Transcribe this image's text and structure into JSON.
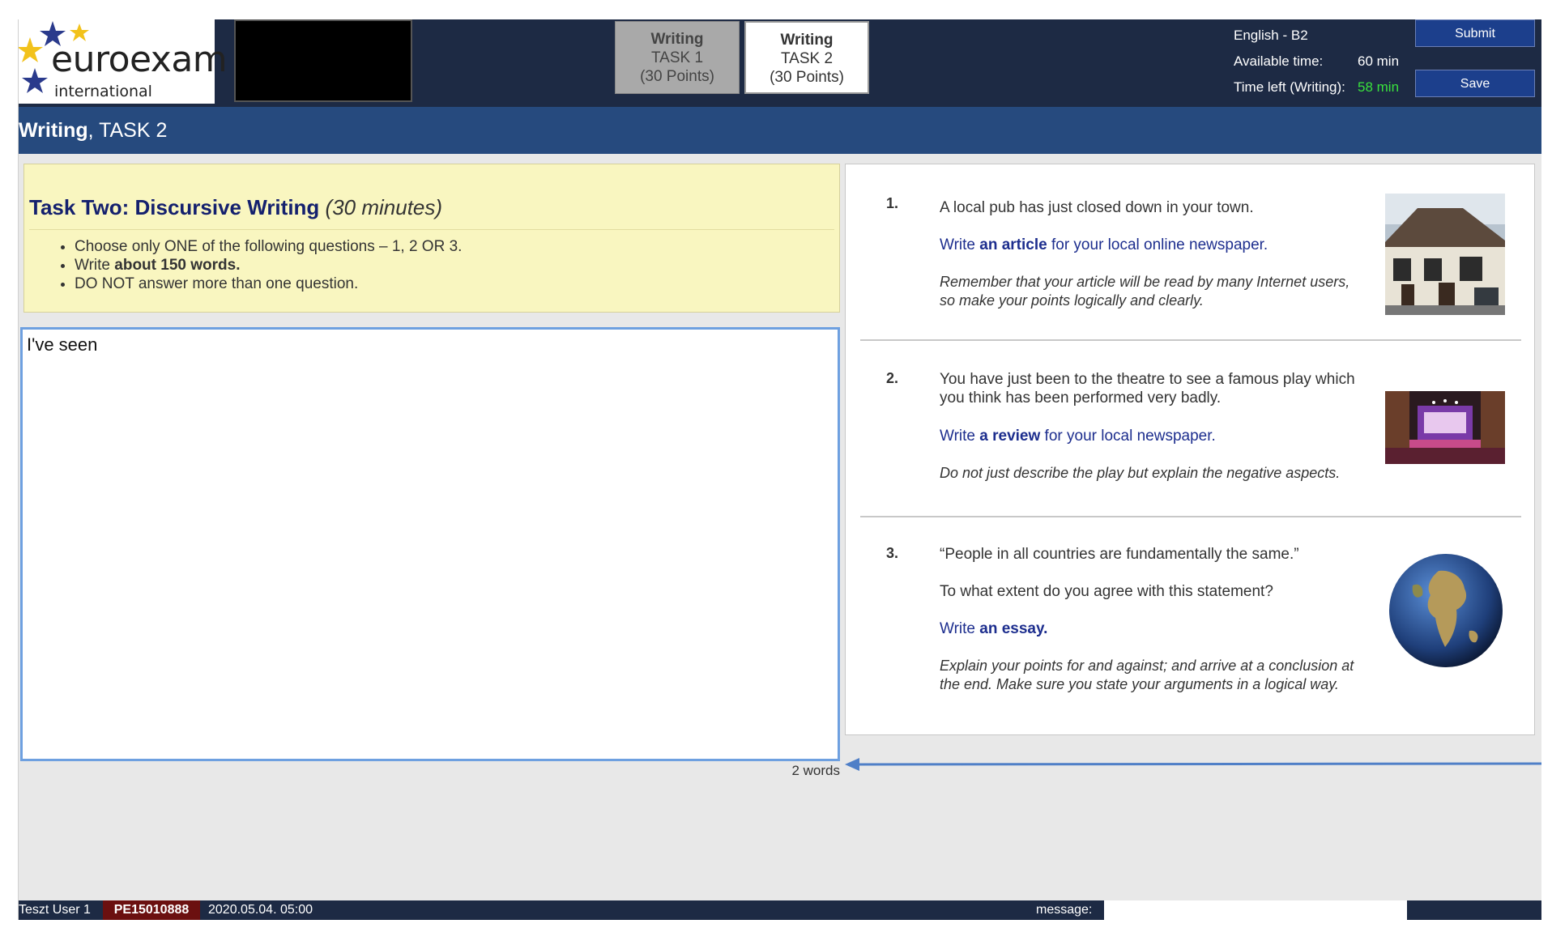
{
  "header": {
    "logo": {
      "word": "euroexam",
      "sub": "international"
    },
    "tabs": [
      {
        "line1": "Writing",
        "line2": "TASK 1",
        "line3": "(30 Points)",
        "active": false
      },
      {
        "line1": "Writing",
        "line2": "TASK 2",
        "line3": "(30 Points)",
        "active": true
      }
    ],
    "info": {
      "level": "English - B2",
      "available_label": "Available time:",
      "available_value": "60 min",
      "time_left_label": "Time left (Writing):",
      "time_left_value": "58 min"
    },
    "submit_label": "Submit",
    "save_label": "Save"
  },
  "section": {
    "bold": "Writing",
    "rest": ", TASK 2"
  },
  "instructions": {
    "title": "Task Two: Discursive Writing",
    "duration": "(30 minutes)",
    "bullets": {
      "b1": "Choose only ONE of the following questions – 1, 2 OR 3.",
      "b2_pre": "Write ",
      "b2_bold": "about 150 words.",
      "b3": "DO NOT answer more than one question."
    }
  },
  "answer": {
    "text": "I've seen",
    "word_count": "2 words"
  },
  "questions": [
    {
      "number": "1.",
      "prompt": "A local pub has just closed down in your town.",
      "task_pre": "Write ",
      "task_bold": "an article",
      "task_post": " for your local online newspaper.",
      "note": "Remember that your article will be read by many Internet users, so make your points logically and clearly.",
      "image": "pub-photo"
    },
    {
      "number": "2.",
      "prompt": "You have just been to the theatre to see a famous play which you think has been performed very badly.",
      "task_pre": "Write ",
      "task_bold": "a review",
      "task_post": " for your local newspaper.",
      "note": "Do not just describe the play but explain the negative aspects.",
      "image": "theatre-photo"
    },
    {
      "number": "3.",
      "prompt": "“People in all countries are fundamentally the same.”",
      "prompt2": "To what extent do you agree with this statement?",
      "task_pre": "Write ",
      "task_bold": "an essay.",
      "task_post": "",
      "note": "Explain your points for and against; and arrive at a conclusion at the end. Make sure you state your arguments in a logical way.",
      "image": "globe-image"
    }
  ],
  "footer": {
    "user": "Teszt User 1",
    "candidate_id": "PE15010888",
    "datetime": "2020.05.04. 05:00",
    "message_label": "message:"
  },
  "colors": {
    "header_bg": "#1d2a44",
    "section_bar": "#264a7e",
    "instruction_bg": "#f9f6c0",
    "task_link": "#1d2e8e",
    "time_left": "#39e23c",
    "answer_border": "#6ea0e0",
    "button_bg": "#1c3f8c"
  }
}
